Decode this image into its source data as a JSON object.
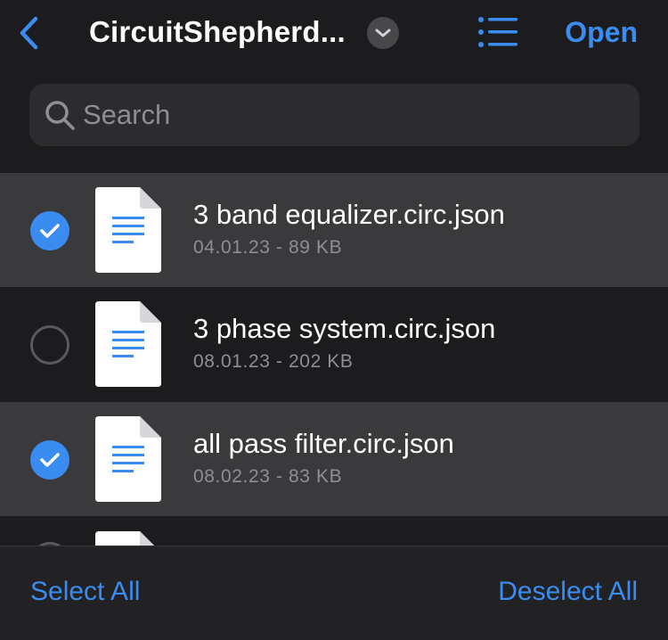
{
  "nav": {
    "title": "CircuitShepherd...",
    "open_label": "Open",
    "back_icon": "chevron-left-icon",
    "title_menu_icon": "chevron-down-icon",
    "list_icon": "list-view-icon"
  },
  "search": {
    "placeholder": "Search",
    "icon": "search-icon"
  },
  "files": [
    {
      "name": "3 band equalizer.circ.json",
      "meta": "04.01.23 - 89 KB",
      "selected": true
    },
    {
      "name": "3 phase system.circ.json",
      "meta": "08.01.23 - 202 KB",
      "selected": false
    },
    {
      "name": "all pass filter.circ.json",
      "meta": "08.02.23 - 83 KB",
      "selected": true
    }
  ],
  "toolbar": {
    "select_all": "Select All",
    "deselect_all": "Deselect All"
  },
  "colors": {
    "accent": "#3b8cf0",
    "background": "#1c1c1e",
    "selected_row": "#3a3a3c",
    "secondary_text": "#8e8e93"
  }
}
